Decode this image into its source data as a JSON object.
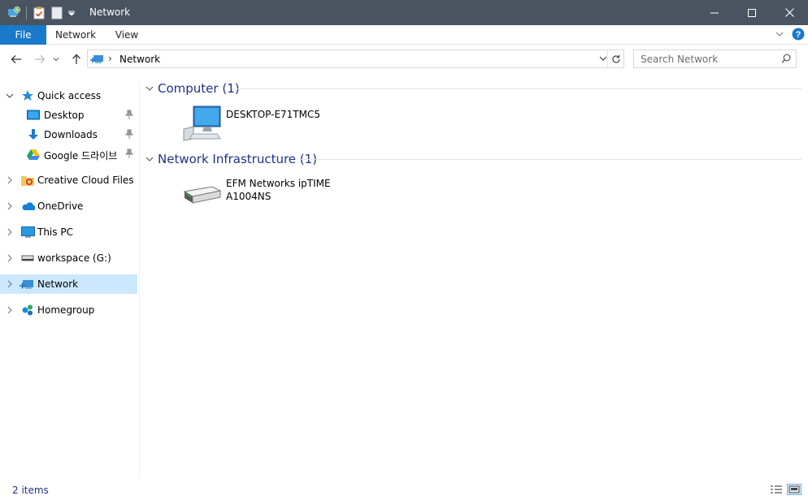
{
  "window": {
    "title": "Network",
    "controls": [
      "minimize",
      "maximize",
      "close"
    ]
  },
  "quick_access_toolbar": {
    "icons": [
      "network-icon",
      "properties-icon",
      "new-folder-icon",
      "customize-dropdown-icon"
    ]
  },
  "ribbon": {
    "tabs": [
      {
        "label": "File"
      },
      {
        "label": "Network"
      },
      {
        "label": "View"
      }
    ]
  },
  "address_bar": {
    "breadcrumb": "Network",
    "search_placeholder": "Search Network"
  },
  "sidebar": {
    "items": [
      {
        "label": "Quick access",
        "icon": "star-icon"
      },
      {
        "label": "Desktop",
        "icon": "desktop-icon",
        "pinned": true
      },
      {
        "label": "Downloads",
        "icon": "download-icon",
        "pinned": true
      },
      {
        "label": "Google 드라이브",
        "icon": "google-drive-icon",
        "pinned": true
      },
      {
        "label": "Creative Cloud Files",
        "icon": "creative-cloud-icon"
      },
      {
        "label": "OneDrive",
        "icon": "cloud-icon"
      },
      {
        "label": "This PC",
        "icon": "computer-icon"
      },
      {
        "label": "workspace (G:)",
        "icon": "drive-icon"
      },
      {
        "label": "Network",
        "icon": "network-icon",
        "selected": true
      },
      {
        "label": "Homegroup",
        "icon": "homegroup-icon"
      }
    ]
  },
  "content": {
    "groups": [
      {
        "title": "Computer (1)",
        "items": [
          {
            "name": "DESKTOP-E71TMC5",
            "icon": "computer-icon"
          }
        ]
      },
      {
        "title": "Network Infrastructure (1)",
        "items": [
          {
            "name_line1": "EFM Networks ipTIME",
            "name_line2": "A1004NS",
            "icon": "router-icon"
          }
        ]
      }
    ]
  },
  "status_bar": {
    "item_count": "2 items"
  },
  "colors": {
    "titlebar": "#4a5460",
    "file_tab": "#1979ca",
    "selection": "#cce8ff",
    "group_title": "#1e3287"
  }
}
